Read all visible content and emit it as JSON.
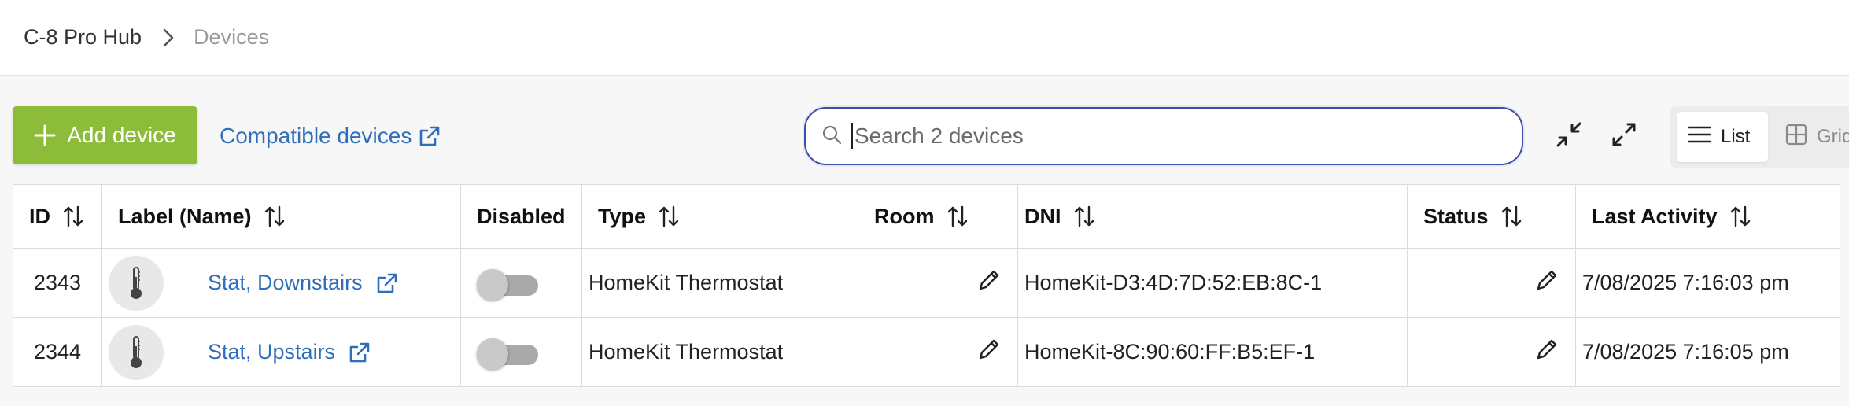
{
  "breadcrumb": {
    "hub": "C-8 Pro Hub",
    "current": "Devices"
  },
  "toolbar": {
    "add_device_label": "Add device",
    "compatible_devices_label": "Compatible devices",
    "search_placeholder": "Search 2 devices",
    "view_list_label": "List",
    "view_grid_label": "Grid",
    "view_selected": "List"
  },
  "colors": {
    "accent_green": "#8dbb3a",
    "link_blue": "#2f6fba",
    "search_border": "#3d4ea8"
  },
  "table": {
    "columns": [
      "ID",
      "Label (Name)",
      "Disabled",
      "Type",
      "Room",
      "DNI",
      "Status",
      "Last Activity"
    ],
    "rows": [
      {
        "id": "2343",
        "label": "Stat, Downstairs",
        "icon": "thermometer-icon",
        "disabled": false,
        "type": "HomeKit Thermostat",
        "room": "",
        "dni": "HomeKit-D3:4D:7D:52:EB:8C-1",
        "status": "",
        "last_activity": "7/08/2025 7:16:03 pm"
      },
      {
        "id": "2344",
        "label": "Stat, Upstairs",
        "icon": "thermometer-icon",
        "disabled": false,
        "type": "HomeKit Thermostat",
        "room": "",
        "dni": "HomeKit-8C:90:60:FF:B5:EF-1",
        "status": "",
        "last_activity": "7/08/2025 7:16:05 pm"
      }
    ]
  }
}
